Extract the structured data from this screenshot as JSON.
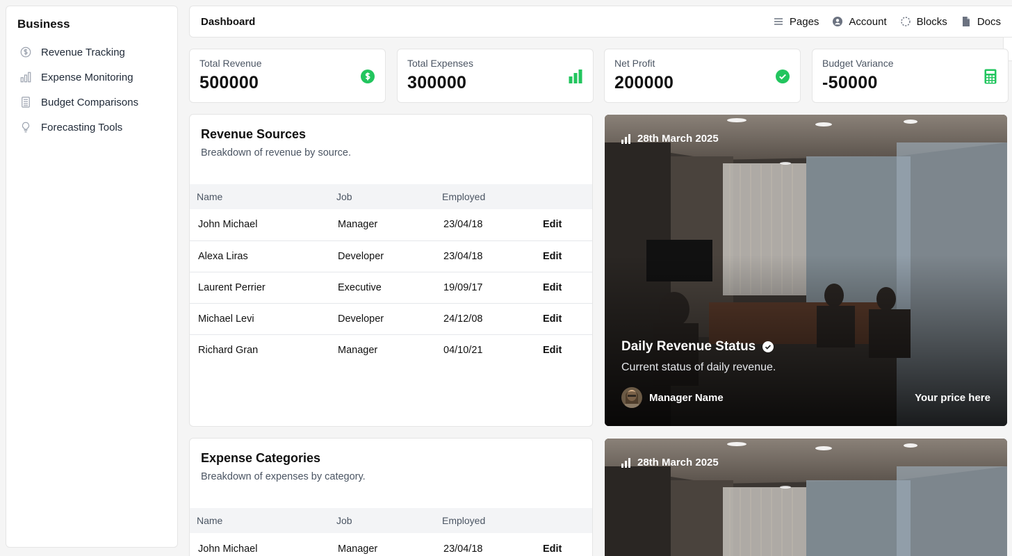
{
  "sidebar": {
    "title": "Business",
    "items": [
      {
        "label": "Revenue Tracking",
        "icon": "dollar-circle-icon"
      },
      {
        "label": "Expense Monitoring",
        "icon": "bar-chart-icon"
      },
      {
        "label": "Budget Comparisons",
        "icon": "calculator-icon"
      },
      {
        "label": "Forecasting Tools",
        "icon": "lightbulb-icon"
      }
    ]
  },
  "header": {
    "title": "Dashboard",
    "nav": [
      {
        "label": "Pages",
        "icon": "menu-lines-icon"
      },
      {
        "label": "Account",
        "icon": "user-circle-icon"
      },
      {
        "label": "Blocks",
        "icon": "dashed-circle-icon"
      },
      {
        "label": "Docs",
        "icon": "document-icon"
      }
    ]
  },
  "stats": [
    {
      "label": "Total Revenue",
      "value": "500000",
      "icon": "dollar-circle-icon"
    },
    {
      "label": "Total Expenses",
      "value": "300000",
      "icon": "bar-chart-icon"
    },
    {
      "label": "Net Profit",
      "value": "200000",
      "icon": "check-circle-icon"
    },
    {
      "label": "Budget Variance",
      "value": "-50000",
      "icon": "calculator-icon"
    }
  ],
  "accent_color": "#22c55e",
  "revenue_table": {
    "title": "Revenue Sources",
    "subtitle": "Breakdown of revenue by source.",
    "columns": [
      "Name",
      "Job",
      "Employed",
      ""
    ],
    "rows": [
      {
        "name": "John Michael",
        "job": "Manager",
        "employed": "23/04/18",
        "action": "Edit"
      },
      {
        "name": "Alexa Liras",
        "job": "Developer",
        "employed": "23/04/18",
        "action": "Edit"
      },
      {
        "name": "Laurent Perrier",
        "job": "Executive",
        "employed": "19/09/17",
        "action": "Edit"
      },
      {
        "name": "Michael Levi",
        "job": "Developer",
        "employed": "24/12/08",
        "action": "Edit"
      },
      {
        "name": "Richard Gran",
        "job": "Manager",
        "employed": "04/10/21",
        "action": "Edit"
      }
    ]
  },
  "expense_table": {
    "title": "Expense Categories",
    "subtitle": "Breakdown of expenses by category.",
    "columns": [
      "Name",
      "Job",
      "Employed",
      ""
    ],
    "rows": [
      {
        "name": "John Michael",
        "job": "Manager",
        "employed": "23/04/18",
        "action": "Edit"
      }
    ]
  },
  "image_cards": [
    {
      "date": "28th March 2025",
      "title": "Daily Revenue Status",
      "subtitle": "Current status of daily revenue.",
      "manager": "Manager Name",
      "price": "Your price here"
    },
    {
      "date": "28th March 2025"
    }
  ]
}
